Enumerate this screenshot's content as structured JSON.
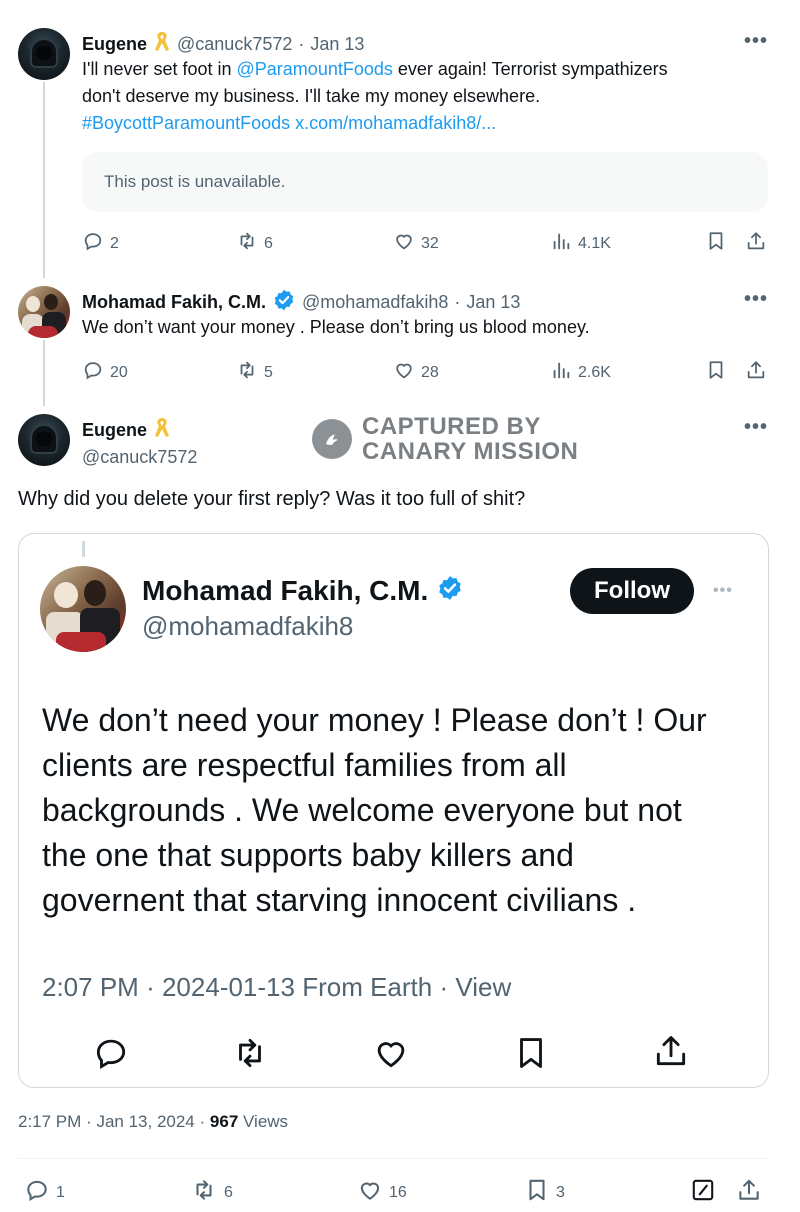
{
  "tweet1": {
    "name": "Eugene",
    "handle": "@canuck7572",
    "dot": "·",
    "date": "Jan 13",
    "more": "•••",
    "text_line1_pre": "I'll never set foot in ",
    "text_mention": "@ParamountFoods",
    "text_line1_post": " ever again! Terrorist sympathizers",
    "text_line2": "don't deserve my business. I'll take my money elsewhere.",
    "hashtag": "#BoycottParamountFoods",
    "link": "x.com/mohamadfakih8/...",
    "unavailable": "This post is unavailable.",
    "replies": "2",
    "reposts": "6",
    "likes": "32",
    "views": "4.1K"
  },
  "tweet2": {
    "name": "Mohamad Fakih, C.M.",
    "handle": "@mohamadfakih8",
    "dot": "·",
    "date": "Jan 13",
    "more": "•••",
    "text": "We don’t want your money . Please don’t bring us blood money.",
    "replies": "20",
    "reposts": "5",
    "likes": "28",
    "views": "2.6K"
  },
  "main": {
    "name": "Eugene",
    "handle": "@canuck7572",
    "more": "•••",
    "text": "Why did you delete your first reply?  Was it too full of shit?",
    "watermark_line1": "CAPTURED BY",
    "watermark_line2": "CANARY MISSION"
  },
  "quote": {
    "name": "Mohamad Fakih, C.M.",
    "handle": "@mohamadfakih8",
    "follow": "Follow",
    "more": "•••",
    "text_lines": [
      "We don’t need your money ! Please don’t ! Our",
      "clients are respectful families from all",
      "backgrounds . We welcome everyone but not",
      "the one that supports baby killers and",
      "governent that starving innocent civilians ."
    ],
    "meta_time": "2:07 PM",
    "meta_sep1": "·",
    "meta_date_from": "2024-01-13 From Earth",
    "meta_sep2": "·",
    "meta_view": "View"
  },
  "footer": {
    "time": "2:17 PM",
    "sep1": "·",
    "date": "Jan 13, 2024",
    "sep2": "·",
    "views_count": "967",
    "views_label": "Views",
    "replies": "1",
    "reposts": "6",
    "likes": "16",
    "bookmarks": "3"
  },
  "colors": {
    "accent": "#1d9bf0",
    "text": "#0f1419",
    "muted": "#536471",
    "ribbon": "#f4c13d"
  }
}
